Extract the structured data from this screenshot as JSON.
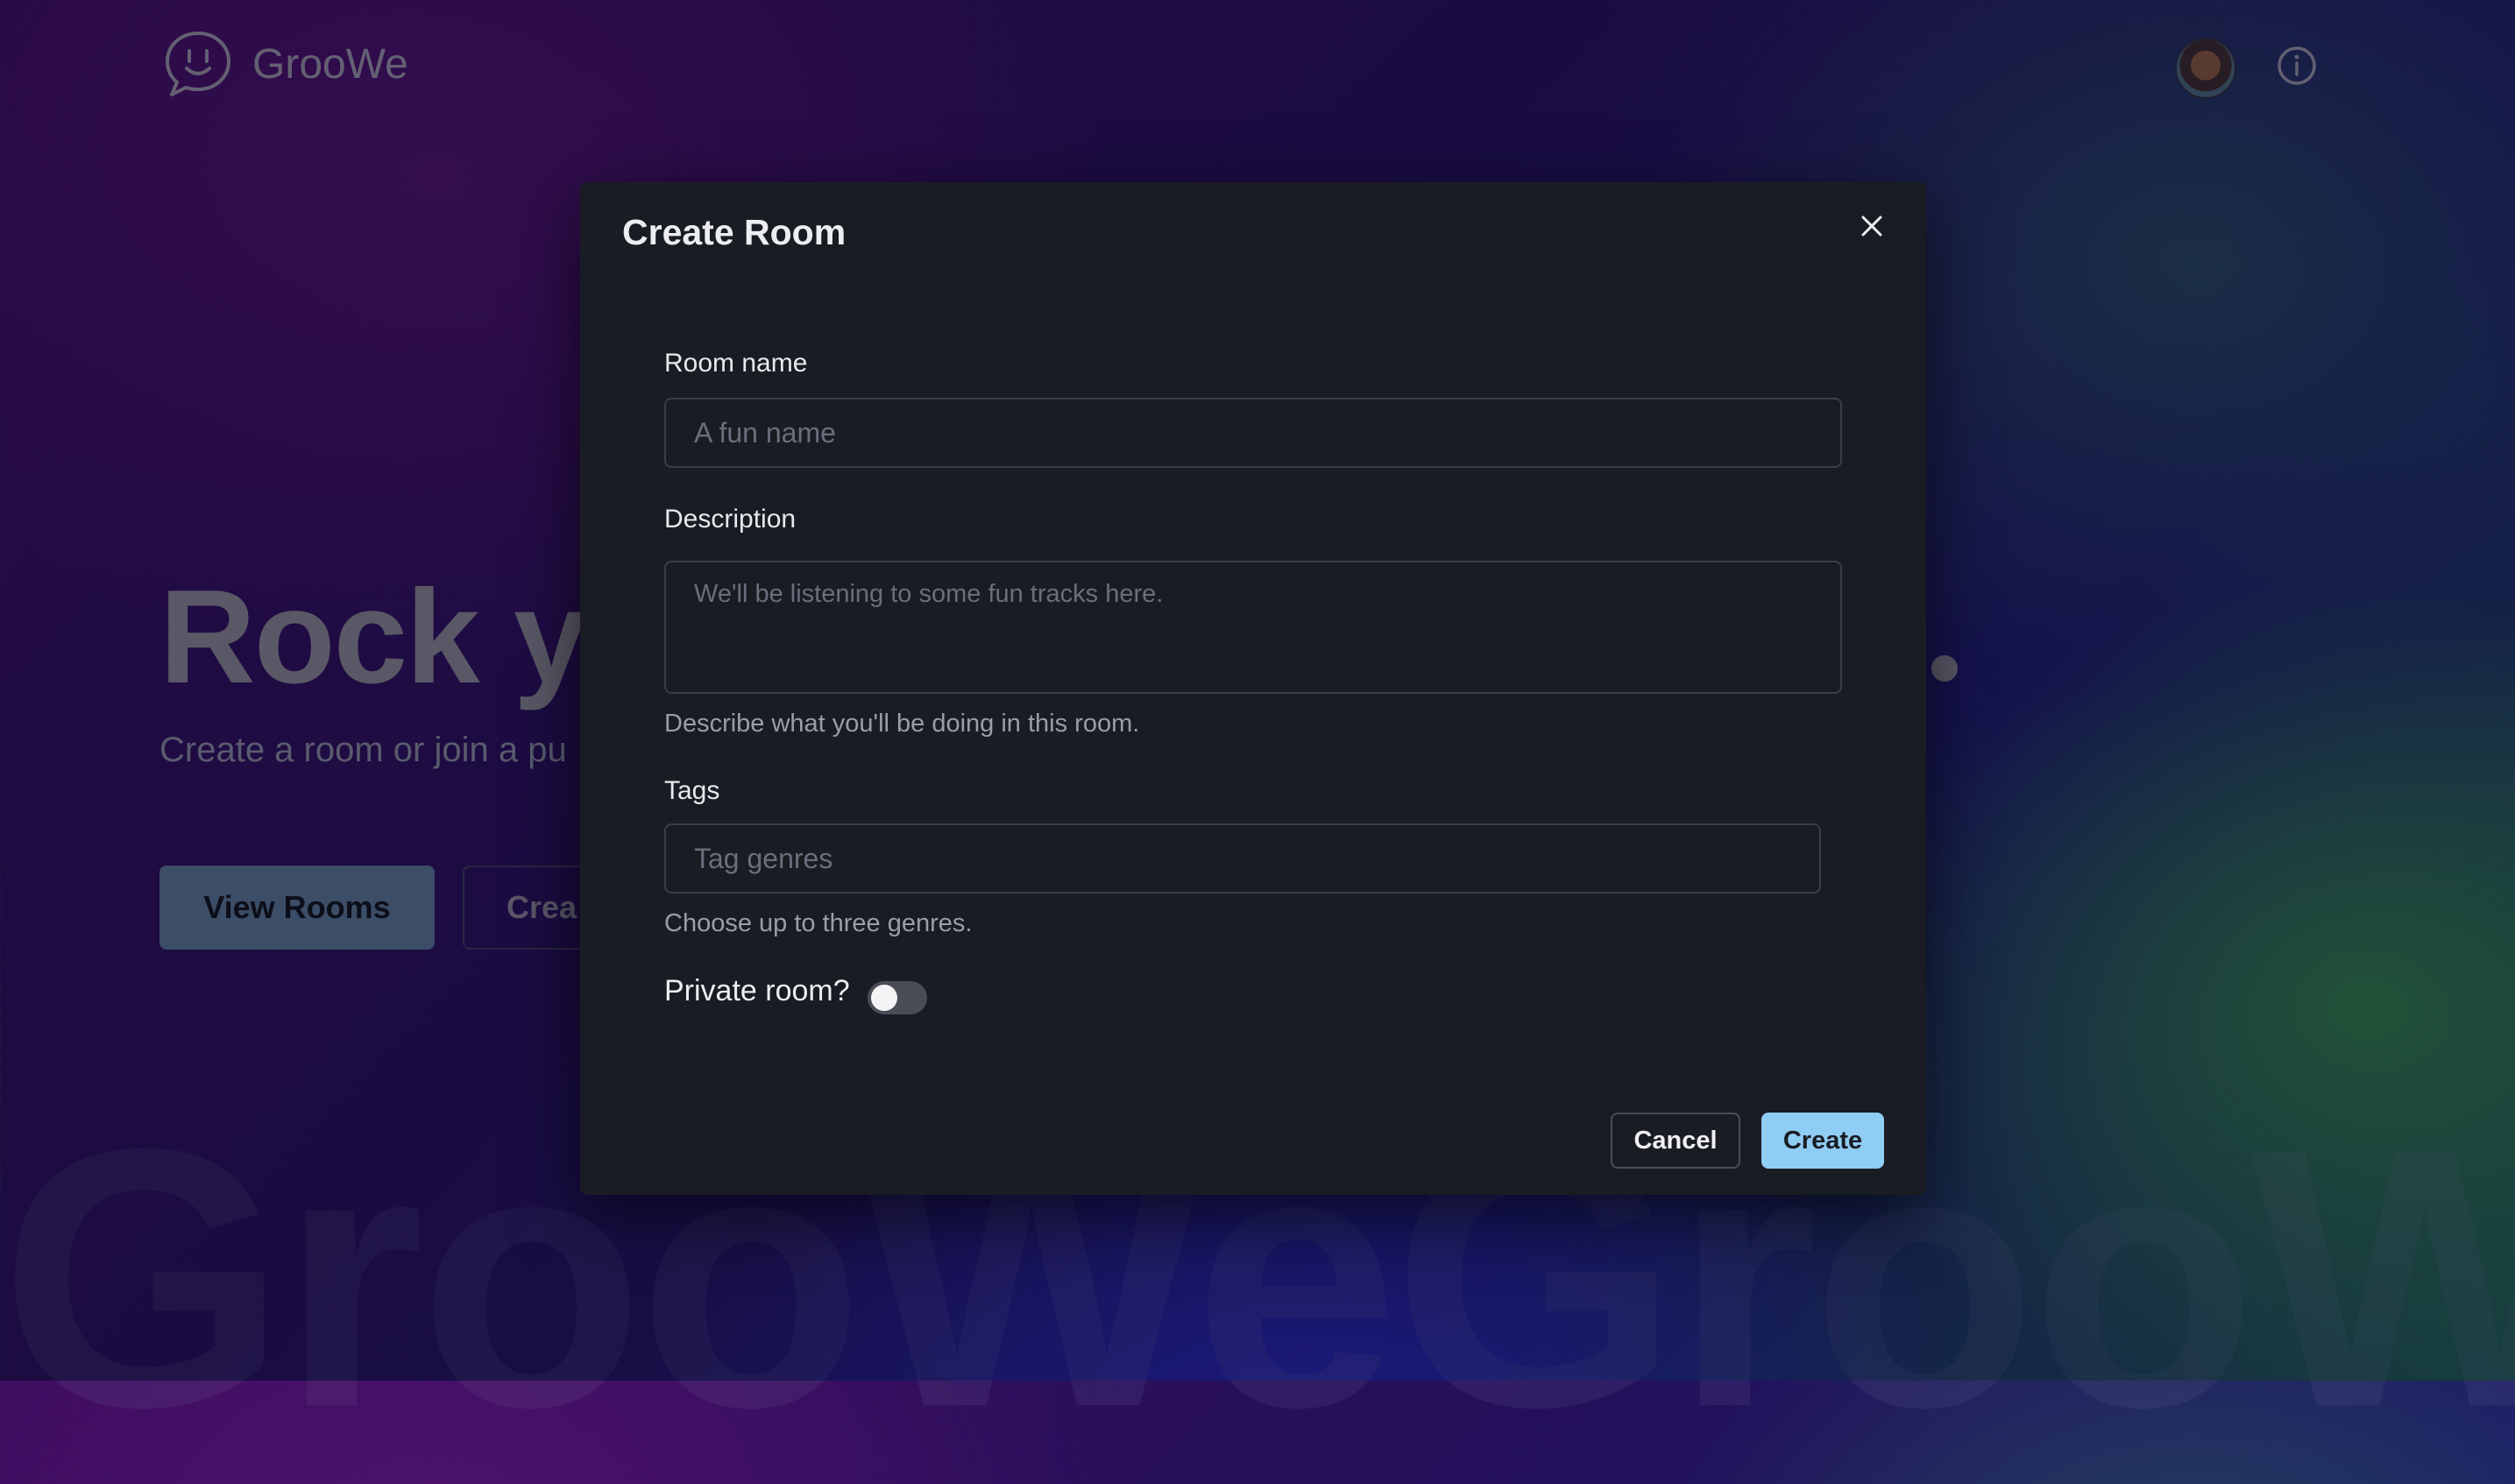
{
  "app": {
    "name": "GrooWe",
    "logo_icon": "chat-bubble-smile-icon",
    "info_icon": "info-circle-icon",
    "avatar_alt": "user-avatar"
  },
  "hero": {
    "title": "Rock y",
    "subtitle": "Create a room or join a pu",
    "view_rooms_label": "View Rooms",
    "create_room_label": "Crea",
    "watermark": "GrooWeGrooW"
  },
  "modal": {
    "title": "Create Room",
    "close_icon": "close-icon",
    "fields": {
      "room_name": {
        "label": "Room name",
        "value": "",
        "placeholder": "A fun name"
      },
      "description": {
        "label": "Description",
        "value": "",
        "placeholder": "We'll be listening to some fun tracks here.",
        "helper": "Describe what you'll be doing in this room."
      },
      "tags": {
        "label": "Tags",
        "value": "",
        "placeholder": "Tag genres",
        "helper": "Choose up to three genres."
      },
      "private": {
        "label": "Private room?",
        "checked": false
      }
    },
    "cancel_label": "Cancel",
    "create_label": "Create"
  },
  "colors": {
    "accent": "#90cdf4",
    "modal_bg": "#1a1c24",
    "view_rooms_bg": "#5b7895"
  }
}
